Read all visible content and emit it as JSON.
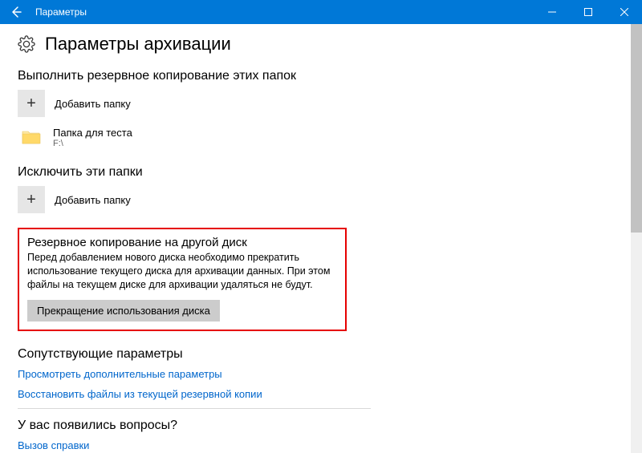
{
  "titlebar": {
    "title": "Параметры"
  },
  "page": {
    "title": "Параметры архивации"
  },
  "backup_folders": {
    "heading": "Выполнить резервное копирование этих папок",
    "add_label": "Добавить папку",
    "items": [
      {
        "name": "Папка для теста",
        "path": "F:\\"
      }
    ]
  },
  "exclude_folders": {
    "heading": "Исключить эти папки",
    "add_label": "Добавить папку"
  },
  "other_drive": {
    "heading": "Резервное копирование на другой диск",
    "description": "Перед добавлением нового диска необходимо прекратить использование текущего диска для архивации данных. При этом файлы на текущем диске для архивации удаляться не будут.",
    "button": "Прекращение использования диска"
  },
  "related": {
    "heading": "Сопутствующие параметры",
    "link_more": "Просмотреть дополнительные параметры",
    "link_restore": "Восстановить файлы из текущей резервной копии"
  },
  "help": {
    "heading": "У вас появились вопросы?",
    "link": "Вызов справки"
  }
}
